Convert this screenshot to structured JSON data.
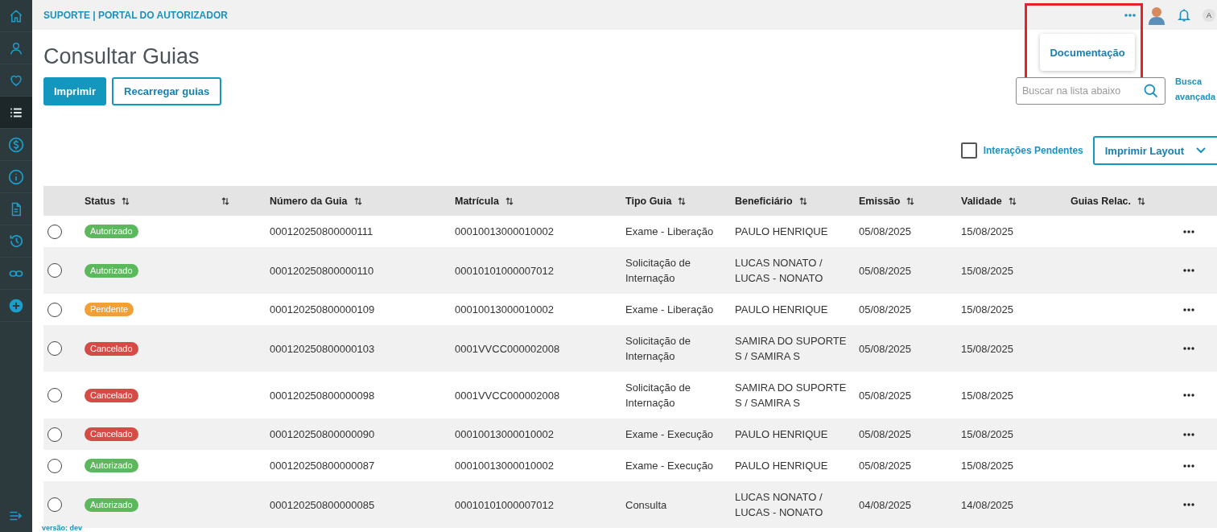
{
  "sidebar": {
    "items": [
      {
        "kind": "home",
        "selected": false
      },
      {
        "kind": "user",
        "selected": false
      },
      {
        "kind": "heart",
        "selected": false
      },
      {
        "kind": "list",
        "selected": true
      },
      {
        "kind": "dollar",
        "selected": false
      },
      {
        "kind": "info",
        "selected": false
      },
      {
        "kind": "document",
        "selected": false
      },
      {
        "kind": "history",
        "selected": false
      },
      {
        "kind": "link",
        "selected": false
      },
      {
        "kind": "plus",
        "selected": false
      }
    ]
  },
  "topbar": {
    "breadcrumb": "SUPORTE | PORTAL DO AUTORIZADOR",
    "more_menu": {
      "items": [
        "Documentação"
      ]
    },
    "user_initial": "A"
  },
  "page": {
    "title": "Consultar Guias",
    "buttons": [
      {
        "label": "Imprimir",
        "kind": "primary"
      },
      {
        "label": "Recarregar guias",
        "kind": "secondary"
      }
    ],
    "search": {
      "placeholder": "Buscar na lista abaixo"
    },
    "advanced_search": "Busca avançada",
    "pending_filter": {
      "label": "Interações Pendentes",
      "checked": false
    },
    "layout_dropdown": "Imprimir Layout"
  },
  "table": {
    "columns": [
      {
        "kind": "label",
        "label": "Status"
      },
      {
        "kind": "sort"
      },
      {
        "kind": "label",
        "label": "Número da Guia"
      },
      {
        "kind": "label",
        "label": "Matrícula"
      },
      {
        "kind": "label",
        "label": "Tipo Guia"
      },
      {
        "kind": "label",
        "label": "Beneficiário"
      },
      {
        "kind": "label",
        "label": "Emissão"
      },
      {
        "kind": "label",
        "label": "Validade"
      },
      {
        "kind": "label",
        "label": "Guias Relac."
      }
    ],
    "rows": [
      {
        "selected": false,
        "status": {
          "label": "Autorizado",
          "color": "#5cb85c"
        },
        "numero": "000120250800000111",
        "matricula": "00010013000010002",
        "tipo": "Exame - Liberação",
        "beneficiario": "PAULO HENRIQUE",
        "emissao": "05/08/2025",
        "validade": "15/08/2025"
      },
      {
        "selected": false,
        "status": {
          "label": "Autorizado",
          "color": "#5cb85c"
        },
        "numero": "000120250800000110",
        "matricula": "00010101000007012",
        "tipo": "Solicitação de Internação",
        "beneficiario": "LUCAS NONATO / LUCAS - NONATO",
        "emissao": "05/08/2025",
        "validade": "15/08/2025"
      },
      {
        "selected": false,
        "status": {
          "label": "Pendente",
          "color": "#f0a035"
        },
        "numero": "000120250800000109",
        "matricula": "00010013000010002",
        "tipo": "Exame - Liberação",
        "beneficiario": "PAULO HENRIQUE",
        "emissao": "05/08/2025",
        "validade": "15/08/2025"
      },
      {
        "selected": false,
        "status": {
          "label": "Cancelado",
          "color": "#d54b45"
        },
        "numero": "000120250800000103",
        "matricula": "0001VVCC000002008",
        "tipo": "Solicitação de Internação",
        "beneficiario": "SAMIRA DO SUPORTE S / SAMIRA S",
        "emissao": "05/08/2025",
        "validade": "15/08/2025"
      },
      {
        "selected": false,
        "status": {
          "label": "Cancelado",
          "color": "#d54b45"
        },
        "numero": "000120250800000098",
        "matricula": "0001VVCC000002008",
        "tipo": "Solicitação de Internação",
        "beneficiario": "SAMIRA DO SUPORTE S / SAMIRA S",
        "emissao": "05/08/2025",
        "validade": "15/08/2025"
      },
      {
        "selected": false,
        "status": {
          "label": "Cancelado",
          "color": "#d54b45"
        },
        "numero": "000120250800000090",
        "matricula": "00010013000010002",
        "tipo": "Exame - Execução",
        "beneficiario": "PAULO HENRIQUE",
        "emissao": "05/08/2025",
        "validade": "15/08/2025"
      },
      {
        "selected": false,
        "status": {
          "label": "Autorizado",
          "color": "#5cb85c"
        },
        "numero": "000120250800000087",
        "matricula": "00010013000010002",
        "tipo": "Exame - Execução",
        "beneficiario": "PAULO HENRIQUE",
        "emissao": "05/08/2025",
        "validade": "15/08/2025"
      },
      {
        "selected": false,
        "status": {
          "label": "Autorizado",
          "color": "#5cb85c"
        },
        "numero": "000120250800000085",
        "matricula": "00010101000007012",
        "tipo": "Consulta",
        "beneficiario": "LUCAS NONATO / LUCAS - NONATO",
        "emissao": "04/08/2025",
        "validade": "14/08/2025"
      }
    ]
  },
  "footer": {
    "version": "versão: dev"
  }
}
